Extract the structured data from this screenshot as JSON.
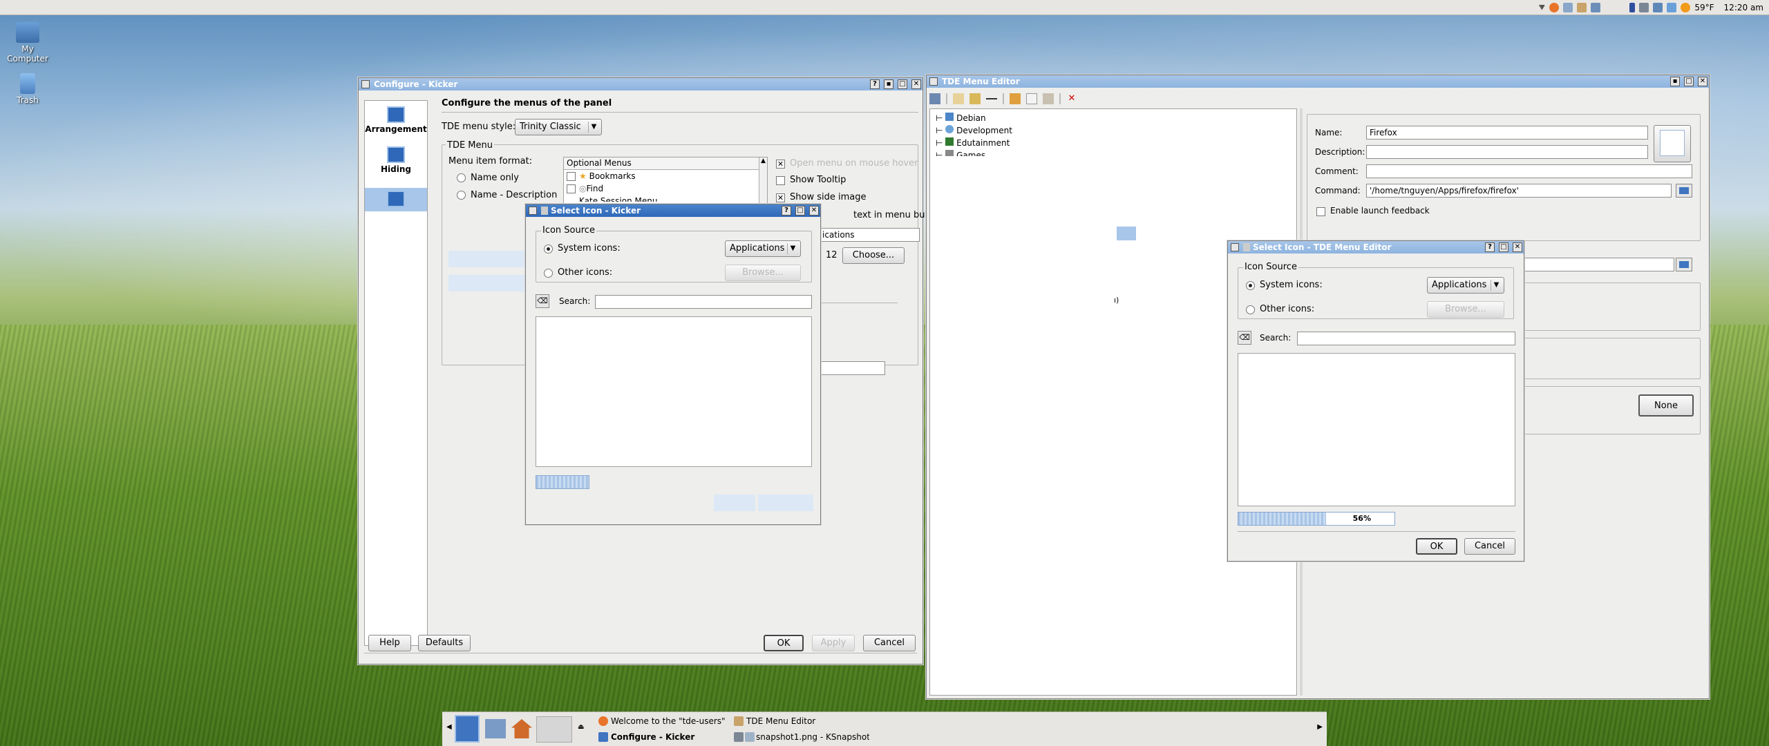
{
  "topbar": {
    "weather": "59°F",
    "clock": "12:20 am"
  },
  "desktop": {
    "icons": [
      {
        "label": "My Computer"
      },
      {
        "label": "Trash"
      }
    ]
  },
  "kicker": {
    "title": "Configure - Kicker",
    "sidebar": [
      {
        "label": "Arrangement"
      },
      {
        "label": "Hiding"
      },
      {
        "label": ""
      }
    ],
    "heading": "Configure the menus of the panel",
    "menu_style_label": "TDE menu style:",
    "menu_style_value": "Trinity Classic",
    "group_title": "TDE Menu",
    "format_label": "Menu item format:",
    "radio_name_only": "Name only",
    "radio_name_desc": "Name - Description",
    "optional_header": "Optional Menus",
    "optional_items": [
      "Bookmarks",
      "Find",
      "Kate Session Menu"
    ],
    "open_on_hover": "Open menu on mouse hover",
    "show_tooltip": "Show Tooltip",
    "show_side_image": "Show side image",
    "text_in_menu": "text in menu buttor",
    "applications_partial": "ications",
    "size_value": "12",
    "choose": "Choose...",
    "help": "Help",
    "defaults": "Defaults",
    "ok": "OK",
    "apply": "Apply",
    "cancel": "Cancel"
  },
  "select_kicker": {
    "title": "Select Icon - Kicker",
    "source_group": "Icon Source",
    "system_icons": "System icons:",
    "other_icons": "Other icons:",
    "category": "Applications",
    "browse": "Browse...",
    "search_label": "Search:",
    "search_value": ""
  },
  "menu_editor": {
    "title": "TDE Menu Editor",
    "tree": [
      "Debian",
      "Development",
      "Edutainment",
      "Games"
    ],
    "name_label": "Name:",
    "name_value": "Firefox",
    "desc_label": "Description:",
    "desc_value": "",
    "comment_label": "Comment:",
    "comment_value": "",
    "command_label": "Command:",
    "command_value": "'/home/tnguyen/Apps/firefox/firefox'",
    "launch_feedback": "Enable launch feedback",
    "none_button": "None",
    "stray_text": "ı)"
  },
  "select_editor": {
    "title": "Select Icon - TDE Menu Editor",
    "source_group": "Icon Source",
    "system_icons": "System icons:",
    "other_icons": "Other icons:",
    "category": "Applications",
    "browse": "Browse...",
    "search_label": "Search:",
    "search_value": "",
    "progress": "56%",
    "progress_value": 0.56,
    "ok": "OK",
    "cancel": "Cancel"
  },
  "taskbar": {
    "items": [
      "Welcome to the \"tde-users\" mai",
      "TDE Menu Editor",
      "Configure - Kicker",
      "snapshot1.png - KSnapshot"
    ]
  }
}
